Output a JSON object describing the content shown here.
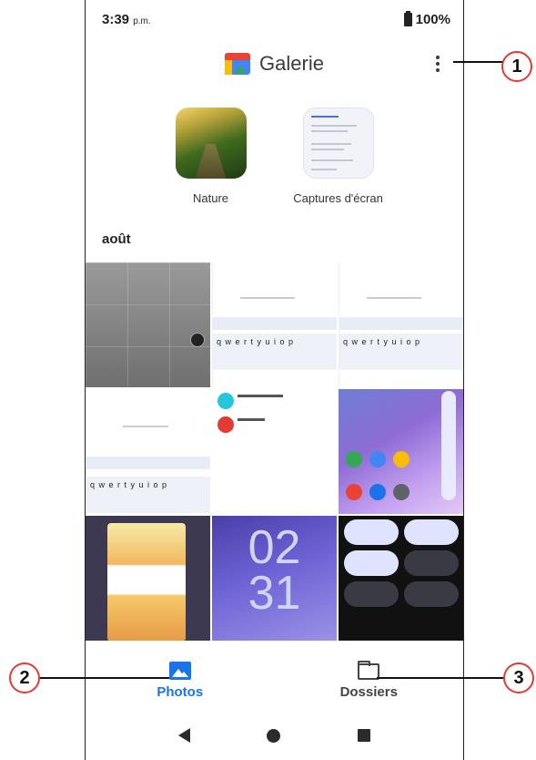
{
  "status_bar": {
    "time": "3:39",
    "time_suffix": "p.m.",
    "battery": "100%"
  },
  "app_bar": {
    "title": "Galerie",
    "logo_icon": "google-photos-logo-icon",
    "menu_icon": "more-vert-icon"
  },
  "albums": [
    {
      "label": "Nature"
    },
    {
      "label": "Captures d'écran"
    }
  ],
  "section": {
    "title": "août"
  },
  "thumbnails": {
    "clock": {
      "hours": "02",
      "minutes": "31"
    }
  },
  "bottom_nav": {
    "items": [
      {
        "label": "Photos",
        "icon": "photos-icon",
        "active": true
      },
      {
        "label": "Dossiers",
        "icon": "folder-icon",
        "active": false
      }
    ]
  },
  "callouts": [
    "1",
    "2",
    "3"
  ],
  "colors": {
    "accent": "#1a73e8",
    "callout_ring": "#e53935"
  }
}
